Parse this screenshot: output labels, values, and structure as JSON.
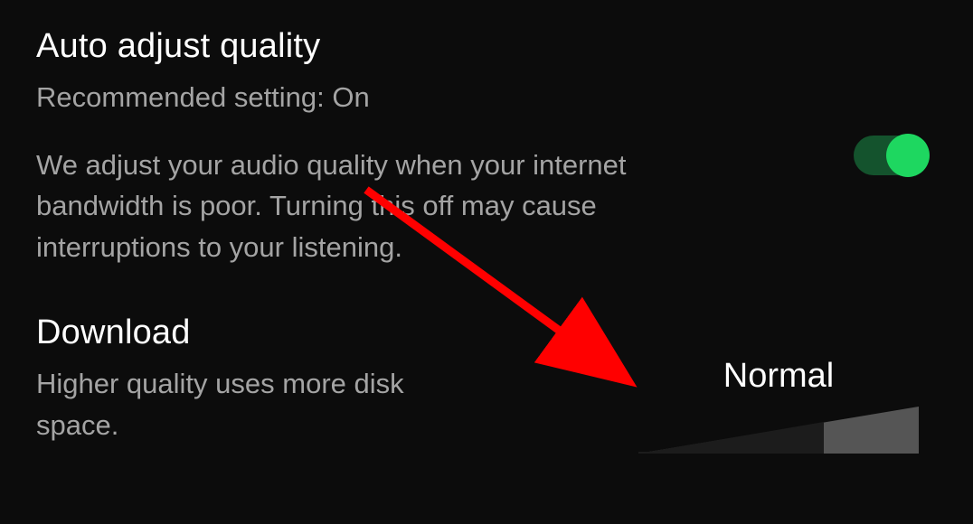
{
  "autoAdjust": {
    "title": "Auto adjust quality",
    "subtitle": "Recommended setting: On",
    "description": "We adjust your audio quality when your internet bandwidth is poor. Turning this off may cause interruptions to your listening.",
    "toggleState": "on"
  },
  "download": {
    "title": "Download",
    "description": "Higher quality uses more disk space.",
    "value": "Normal"
  }
}
